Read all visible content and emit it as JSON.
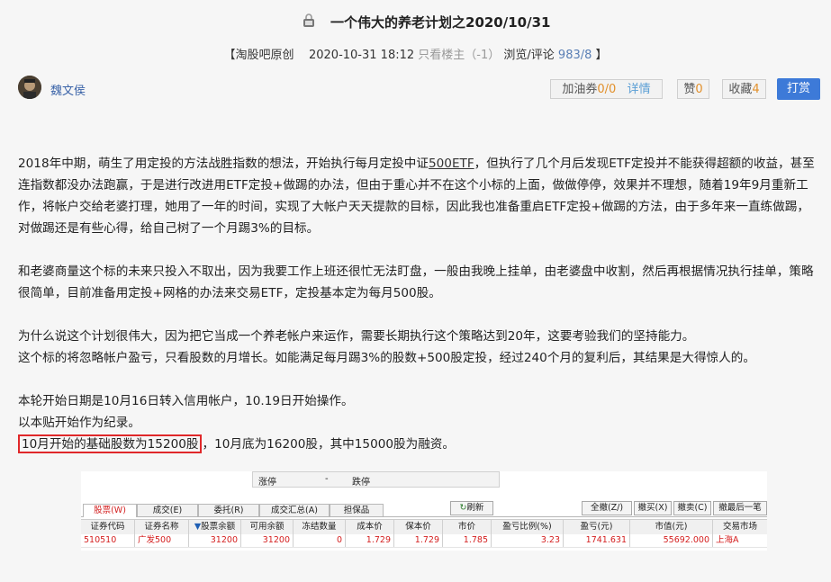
{
  "post": {
    "title": "一个伟大的养老计划之2020/10/31",
    "meta": {
      "source": "【淘股吧原创",
      "datetime": "2020-10-31 18:12",
      "only_op": "只看楼主（-1）",
      "views_label": "浏览/评论",
      "views_value": "983/8",
      "close": "】"
    },
    "author": "魏文侯",
    "actions": {
      "coupon_label": "加油券",
      "coupon_value": "0/0",
      "details": "详情",
      "like_label": "赞",
      "like_value": "0",
      "collect_label": "收藏",
      "collect_value": "4",
      "tip": "打赏"
    },
    "p1_a": "2018年中期，萌生了用定投的方法战胜指数的想法，开始执行每月定投中证",
    "p1_link": "500ETF",
    "p1_b": "，但执行了几个月后发现ETF定投并不能获得超额的收益，甚至连指数都没办法跑赢，于是进行改进用ETF定投+做踢的办法，但由于重心并不在这个小标的上面，做做停停，效果并不理想，随着19年9月重新工作，将帐户交给老婆打理，她用了一年的时间，实现了大帐户天天提款的目标，因此我也准备重启ETF定投+做踢的方法，由于多年来一直练做踢，对做踢还是有些心得，给自己树了一个月踢3%的目标。",
    "p2": "和老婆商量这个标的未来只投入不取出，因为我要工作上班还很忙无法盯盘，一般由我晚上挂单，由老婆盘中收割，然后再根据情况执行挂单，策略很简单，目前准备用定投+网格的办法来交易ETF，定投基本定为每月500股。",
    "p3_line1": "为什么说这个计划很伟大，因为把它当成一个养老帐户来运作，需要长期执行这个策略达到20年，这要考验我们的坚持能力。",
    "p3_line2": "这个标的将忽略帐户盈亏，只看股数的月增长。如能满足每月踢3%的股数+500股定投，经过240个月的复利后，其结果是大得惊人的。",
    "p4_line1": "本轮开始日期是10月16日转入信用帐户，10.19日开始操作。",
    "p4_line2": "以本贴开始作为纪录。",
    "p4_highlight": "10月开始的基础股数为15200股",
    "p4_rest": "，10月底为16200股，其中15000股为融资。"
  },
  "screenshot": {
    "limit_up": "涨停",
    "dash": "-",
    "limit_down": "跌停",
    "tabs": [
      "股票(W)",
      "成交(E)",
      "委托(R)",
      "成交汇总(A)",
      "担保品"
    ],
    "refresh": "刷新",
    "buttons": [
      "全撤(Z/)",
      "撤买(X)",
      "撤卖(C)",
      "撤最后一笔"
    ],
    "columns": [
      "证券代码",
      "证券名称",
      "股票余额",
      "可用余额",
      "冻结数量",
      "成本价",
      "保本价",
      "市价",
      "盈亏比例(%)",
      "盈亏(元)",
      "市值(元)",
      "交易市场"
    ],
    "row": [
      "510510",
      "广发500",
      "31200",
      "31200",
      "0",
      "1.729",
      "1.729",
      "1.785",
      "3.23",
      "1741.631",
      "55692.000",
      "上海A"
    ]
  }
}
